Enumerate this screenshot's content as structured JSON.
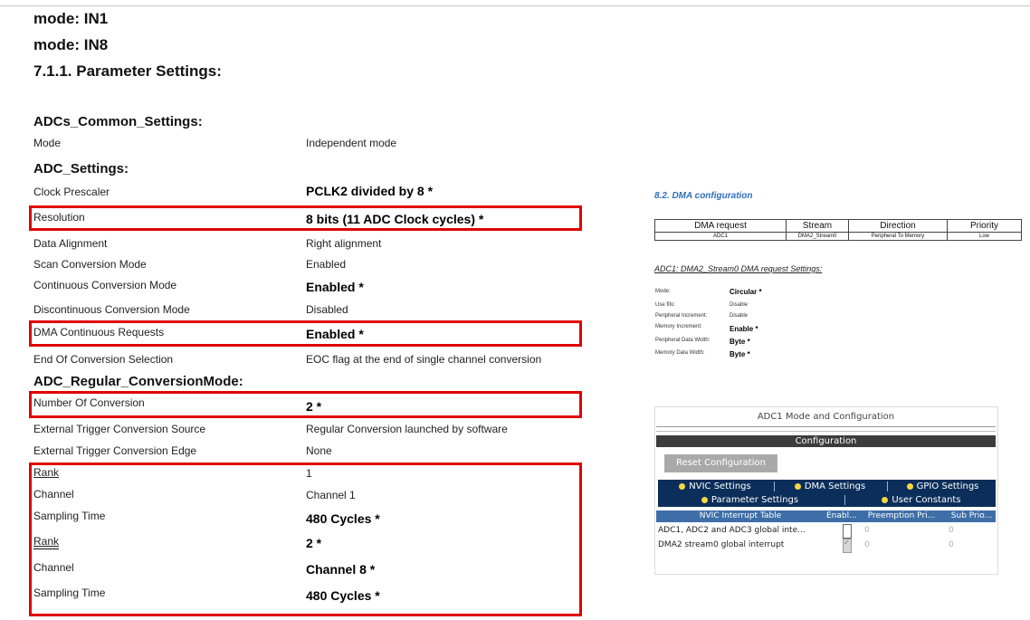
{
  "headings": {
    "mode1": "mode: IN1",
    "mode2": "mode: IN8",
    "param": "7.1.1. Parameter Settings:",
    "common": "ADCs_Common_Settings:",
    "adc": "ADC_Settings:",
    "regular": "ADC_Regular_ConversionMode:"
  },
  "rows": {
    "mode": {
      "label": "Mode",
      "value": "Independent mode"
    },
    "clock": {
      "label": "Clock Prescaler",
      "value": "PCLK2 divided by 8 *"
    },
    "resolution": {
      "label": "Resolution",
      "value": "8 bits (11 ADC Clock cycles) *"
    },
    "alignment": {
      "label": "Data Alignment",
      "value": "Right alignment"
    },
    "scan": {
      "label": "Scan Conversion Mode",
      "value": "Enabled"
    },
    "continuous": {
      "label": "Continuous Conversion Mode",
      "value": "Enabled *"
    },
    "discontinuous": {
      "label": "Discontinuous Conversion Mode",
      "value": "Disabled"
    },
    "dma_req": {
      "label": "DMA Continuous Requests",
      "value": "Enabled *"
    },
    "eoc": {
      "label": "End Of Conversion Selection",
      "value": "EOC flag at the end of single channel conversion"
    },
    "num_conv": {
      "label": "Number Of Conversion",
      "value": "2 *"
    },
    "ext_src": {
      "label": "External Trigger Conversion Source",
      "value": "Regular Conversion launched by software"
    },
    "ext_edge": {
      "label": "External Trigger Conversion Edge",
      "value": "None"
    },
    "rank1": {
      "label": "Rank",
      "value": "1"
    },
    "channel1": {
      "label": "Channel",
      "value": "Channel 1"
    },
    "sampling1": {
      "label": "Sampling Time",
      "value": "480 Cycles *"
    },
    "rank2": {
      "label": "Rank",
      "value": "2 *"
    },
    "channel2": {
      "label": "Channel",
      "value": "Channel 8 *"
    },
    "sampling2": {
      "label": "Sampling Time",
      "value": "480 Cycles *"
    }
  },
  "dma": {
    "title": "8.2. DMA configuration",
    "headers": [
      "DMA request",
      "Stream",
      "Direction",
      "Priority"
    ],
    "row": [
      "ADC1",
      "DMA2_Stream0",
      "Peripheral To Memory",
      "Low"
    ],
    "req_title": "ADC1: DMA2_Stream0 DMA request Settings:",
    "settings": [
      {
        "label": "Mode:",
        "value": "Circular *"
      },
      {
        "label": "Use fifo:",
        "value": "Disable"
      },
      {
        "label": "Peripheral Increment:",
        "value": "Disable"
      },
      {
        "label": "Memory Increment:",
        "value": "Enable *"
      },
      {
        "label": "Peripheral Data Width:",
        "value": "Byte *"
      },
      {
        "label": "Memory Data Width:",
        "value": "Byte *"
      }
    ]
  },
  "config": {
    "panel_title": "ADC1 Mode and Configuration",
    "bar": "Configuration",
    "reset": "Reset Configuration",
    "tabs_row1": [
      "NVIC Settings",
      "DMA Settings",
      "GPIO Settings"
    ],
    "tabs_row2": [
      "Parameter Settings",
      "User Constants"
    ],
    "table_headers": [
      "NVIC Interrupt Table",
      "Enabl...",
      "Preemption Pri...",
      "Sub Prio..."
    ],
    "table_rows": [
      {
        "name": "ADC1, ADC2 and ADC3 global inte...",
        "enabled": false,
        "preemption": "0",
        "sub": "0"
      },
      {
        "name": "DMA2 stream0 global interrupt",
        "enabled": true,
        "preemption": "0",
        "sub": "0"
      }
    ],
    "colors": {
      "tab_bg": "#0b2e5a",
      "header_bg": "#3e6ea8",
      "bar_bg": "#3c3c3c",
      "dot": "#f5d742"
    }
  },
  "colors": {
    "highlight_box": "#e00000",
    "dma_title": "#2f6fbf"
  }
}
